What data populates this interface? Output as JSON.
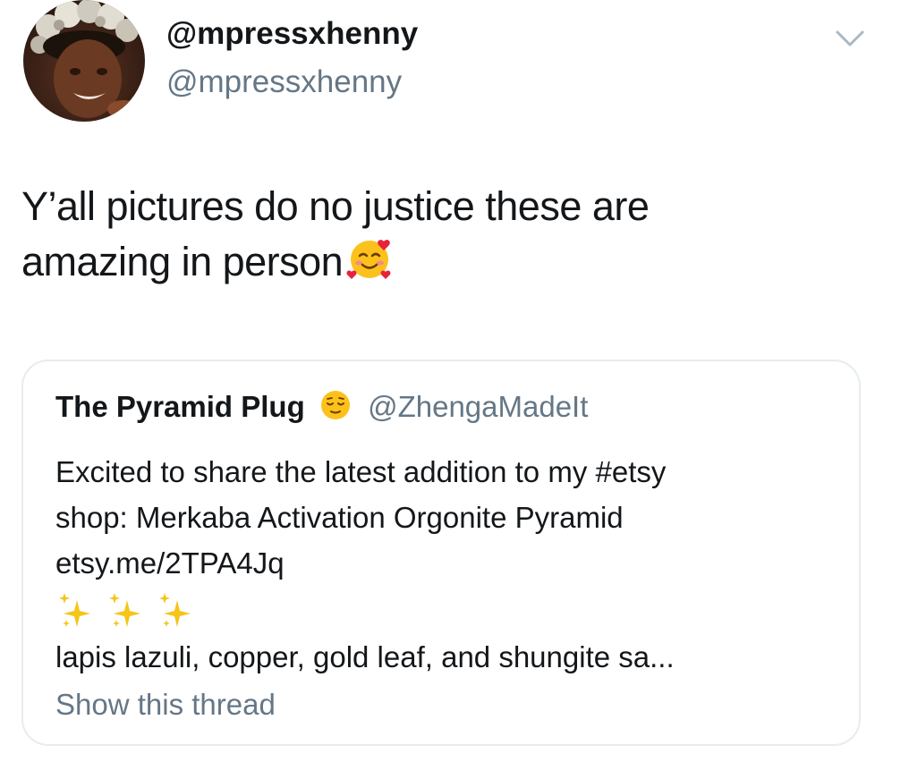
{
  "tweet": {
    "display_name": "@mpressxhenny",
    "handle": "@mpressxhenny",
    "text_line1": "Y’all pictures do no justice these are",
    "text_line2": "amazing in person",
    "text_emoji": "smiling-face-with-hearts-icon"
  },
  "quoted_tweet": {
    "name": "The Pyramid Plug",
    "name_emoji": "relieved-face-icon",
    "handle": "@ZhengaMadeIt",
    "line1": "Excited to share the latest addition to my #etsy",
    "line2": "shop: Merkaba Activation Orgonite Pyramid",
    "line3": "etsy.me/2TPA4Jq",
    "sparkles": "sparkles-icon",
    "line4": "lapis lazuli, copper, gold leaf, and shungite sa...",
    "show_thread": "Show this thread"
  },
  "colors": {
    "text": "#14171a",
    "secondary": "#657786",
    "border": "#e6ecf0"
  }
}
